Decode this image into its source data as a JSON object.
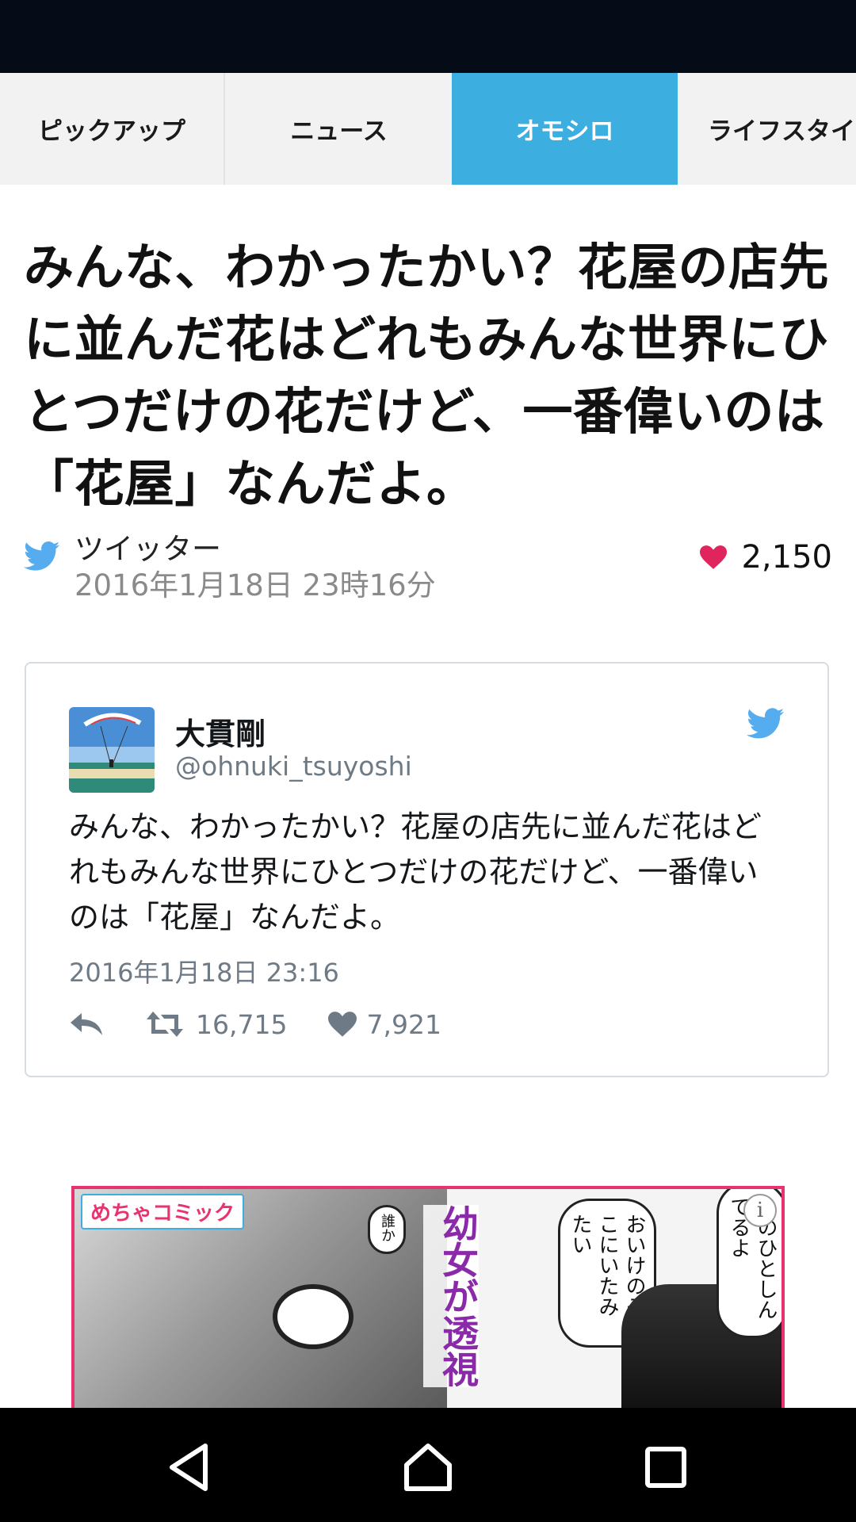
{
  "tabs": [
    {
      "label": "ピックアップ",
      "active": false
    },
    {
      "label": "ニュース",
      "active": false
    },
    {
      "label": "オモシロ",
      "active": true
    },
    {
      "label": "ライフスタイル",
      "active": false
    }
  ],
  "article": {
    "title": "みんな、わかったかい？花屋の店先に並んだ花はどれもみんな世界にひとつだけの花だけど、一番偉いのは「花屋」なんだよ。",
    "source": "ツイッター",
    "date": "2016年1月18日 23時16分",
    "likes": "2,150"
  },
  "tweet": {
    "author_name": "大貫剛",
    "author_handle": "@ohnuki_tsuyoshi",
    "text": "みんな、わかったかい？花屋の店先に並んだ花はどれもみんな世界にひとつだけの花だけど、一番偉いのは「花屋」なんだよ。",
    "timestamp": "2016年1月18日 23:16",
    "retweets": "16,715",
    "likes": "7,921"
  },
  "ad": {
    "logo": "めちゃコミック",
    "vertical_text": "幼女が透視",
    "bubble_1": "おいけのそこにいたみたい",
    "bubble_2": "このひとしんでるよ",
    "bubble_3": "誰か",
    "info_icon": "i"
  },
  "colors": {
    "accent": "#3daee0",
    "status_bar": "#050b17",
    "twitter_blue": "#55acee",
    "heart": "#e0245e",
    "ad_border": "#e8336f"
  },
  "icons": {
    "source": "twitter-bird-icon",
    "like": "heart-icon",
    "reply": "reply-icon",
    "retweet": "retweet-icon",
    "nav_back": "back-triangle-icon",
    "nav_home": "home-icon",
    "nav_recent": "recent-apps-icon"
  }
}
